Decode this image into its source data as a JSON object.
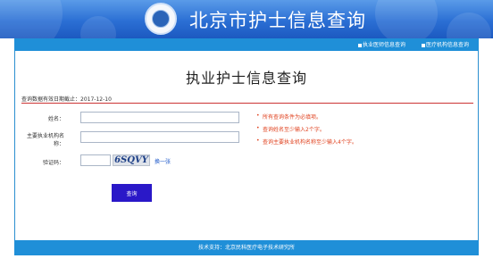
{
  "header": {
    "site_title": "北京市护士信息查询"
  },
  "nav": {
    "links": [
      "执业医师信息查询",
      "医疗机构信息查询"
    ]
  },
  "main": {
    "page_title": "执业护士信息查询",
    "valid_date_label": "查询数据有效日期截止：",
    "valid_date": "2017-12-10",
    "form": {
      "name_label": "姓名：",
      "name_value": "",
      "institution_label_line1": "主要执业机构名",
      "institution_label_line2": "称：",
      "institution_value": "",
      "captcha_label": "验证码：",
      "captcha_value": "",
      "captcha_text": "6SQVY",
      "swap_captcha": "换一张",
      "query_button": "查询"
    },
    "notes": [
      "所有查询条件为必填项。",
      "查询姓名至少输入2个字。",
      "查询主要执业机构名称至少输入4个字。"
    ]
  },
  "footer": {
    "support": "技术支持：北京民科医疗电子技术研究所"
  },
  "colors": {
    "banner_blue": "#2b6fd4",
    "bar_blue": "#1f8fd8",
    "rule_red": "#cc3333",
    "note_red": "#e0421f",
    "button_blue": "#2a18c8"
  }
}
